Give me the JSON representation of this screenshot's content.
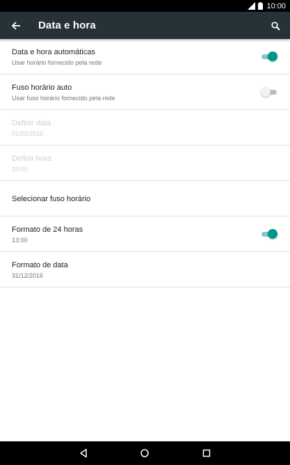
{
  "status_bar": {
    "time": "10:00",
    "icons": [
      "signal-icon",
      "battery-icon"
    ]
  },
  "toolbar": {
    "title": "Data e hora",
    "icons": [
      "back-arrow-icon",
      "search-icon"
    ]
  },
  "settings": [
    {
      "title": "Data e hora automáticas",
      "subtitle": "Usar horário fornecido pela rede",
      "toggle": "on",
      "enabled": true
    },
    {
      "title": "Fuso horário auto",
      "subtitle": "Usar fuso horário fornecido pela rede",
      "toggle": "off",
      "enabled": true
    },
    {
      "title": "Definir data",
      "subtitle": "01/02/2016",
      "enabled": false
    },
    {
      "title": "Definir hora",
      "subtitle": "10:00",
      "enabled": false
    },
    {
      "title": "Selecionar fuso horário",
      "enabled": true
    },
    {
      "title": "Formato de 24 horas",
      "subtitle": "13:00",
      "toggle": "on",
      "enabled": true
    },
    {
      "title": "Formato de data",
      "subtitle": "31/12/2016",
      "enabled": true
    }
  ],
  "nav_bar": {
    "icons": [
      "nav-back-icon",
      "nav-home-icon",
      "nav-recents-icon"
    ]
  },
  "colors": {
    "toolbar": "#263238",
    "accent": "#009688",
    "accent_track": "#80cbc4"
  }
}
